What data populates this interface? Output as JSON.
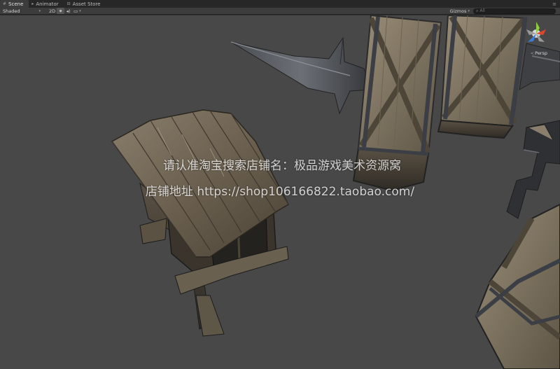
{
  "tabs": [
    {
      "label": "Scene",
      "icon": "scene-icon",
      "active": true
    },
    {
      "label": "Animator",
      "icon": "animator-icon",
      "active": false
    },
    {
      "label": "Asset Store",
      "icon": "asset-store-icon",
      "active": false
    }
  ],
  "toolbar": {
    "shading_mode": "Shaded",
    "mode_2d": "2D",
    "gizmos_label": "Gizmos",
    "search_placeholder": "All"
  },
  "scene_gizmo": {
    "projection": "Persp",
    "axis_colors": {
      "x": "#e0452f",
      "y": "#8ccf3a",
      "z": "#3b7bd8"
    }
  },
  "watermark": {
    "line1": "请认准淘宝搜索店铺名：极品游戏美术资源窝",
    "line2": "店铺地址 https://shop106166822.taobao.com/"
  },
  "colors": {
    "viewport_bg": "#484848",
    "toolbar_bg": "#3c3c3c",
    "tabbar_bg": "#272727"
  }
}
